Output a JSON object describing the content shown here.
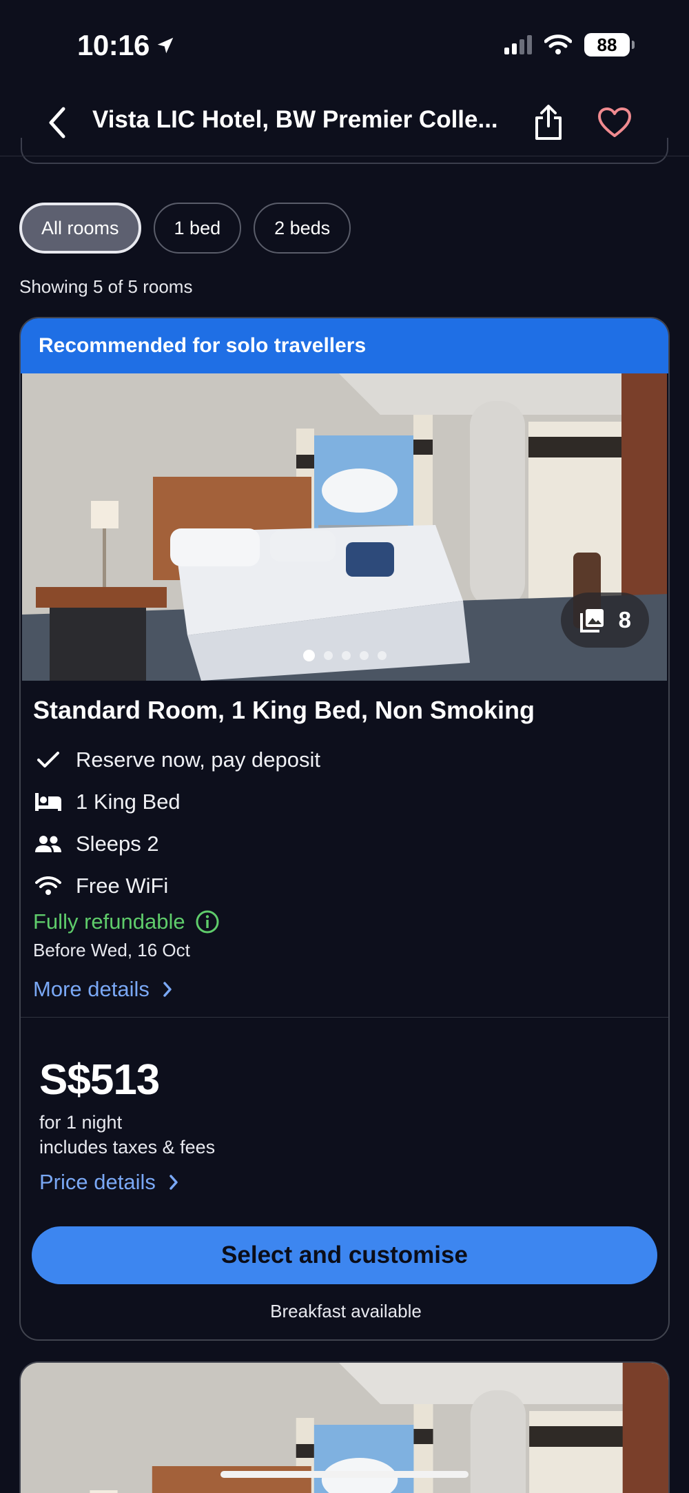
{
  "status_bar": {
    "time": "10:16",
    "battery": "88"
  },
  "header": {
    "title": "Vista LIC Hotel, BW Premier Colle...",
    "back_icon": "chevron-left-icon",
    "share_icon": "share-icon",
    "favorite_icon": "heart-icon",
    "favorite_color": "#f08a8f"
  },
  "filters": {
    "chips": [
      "All rooms",
      "1 bed",
      "2 beds"
    ],
    "active_index": 0
  },
  "showing_text": "Showing 5 of 5 rooms",
  "room": {
    "banner": "Recommended for solo travellers",
    "photo_count": "8",
    "carousel_total": 5,
    "carousel_active": 0,
    "name": "Standard Room, 1 King Bed, Non Smoking",
    "features": [
      {
        "icon": "check-icon",
        "label": "Reserve now, pay deposit"
      },
      {
        "icon": "bed-icon",
        "label": "1 King Bed"
      },
      {
        "icon": "people-icon",
        "label": "Sleeps 2"
      },
      {
        "icon": "wifi-icon",
        "label": "Free WiFi"
      }
    ],
    "refund_label": "Fully refundable",
    "refund_date": "Before Wed, 16 Oct",
    "more_details": "More details",
    "price": "S$513",
    "price_night": "for 1 night",
    "price_taxes": "includes taxes & fees",
    "price_details": "Price details",
    "select_button": "Select and customise",
    "breakfast_note": "Breakfast available"
  },
  "colors": {
    "background": "#0d0f1c",
    "banner": "#1f6fe5",
    "button": "#3d86f0",
    "link": "#7aa8f5",
    "refundable": "#5fcc6b"
  }
}
